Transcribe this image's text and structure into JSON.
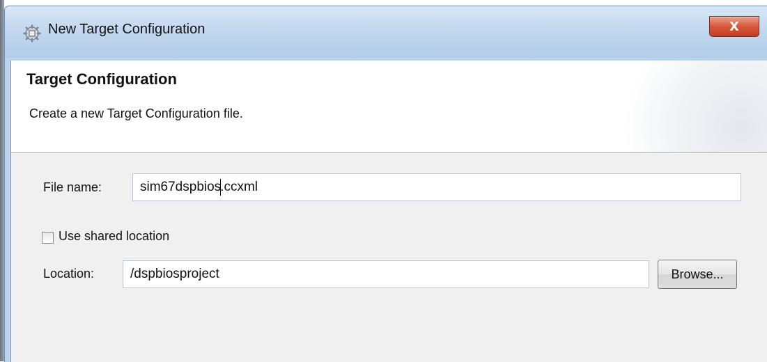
{
  "window": {
    "title": "New Target Configuration",
    "close_glyph": "X",
    "icon": "gear-cube-icon"
  },
  "banner": {
    "title": "Target Configuration",
    "description": "Create a new Target Configuration file."
  },
  "form": {
    "file_name": {
      "label": "File name:",
      "value_before_caret": "sim67dspbios",
      "value_after_caret": ".ccxml"
    },
    "use_shared_location": {
      "label": "Use shared location",
      "checked": false
    },
    "location": {
      "label": "Location:",
      "value": "/dspbiosproject"
    },
    "browse_label": "Browse..."
  },
  "colors": {
    "titlebar": "#c3d8ef",
    "close_button": "#d8583b",
    "dialog_background": "#f0f0f0"
  }
}
